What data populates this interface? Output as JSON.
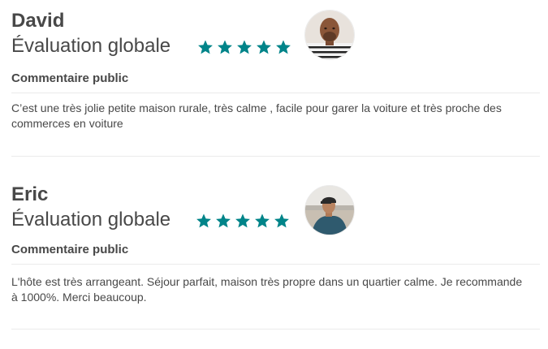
{
  "reviews": [
    {
      "name": "David",
      "rating_label": "Évaluation globale",
      "stars": 5,
      "avatar": "person-avatar",
      "comment_heading": "Commentaire public",
      "comment": "C’est une très jolie petite maison rurale, très calme , facile pour garer la voiture et très proche des commerces en voiture"
    },
    {
      "name": "Eric",
      "rating_label": "Évaluation globale",
      "stars": 5,
      "avatar": "person-avatar",
      "comment_heading": "Commentaire public",
      "comment": "L'hôte est très arrangeant. Séjour parfait, maison très propre dans un quartier calme. Je recommande à 1000%. Merci beaucoup."
    }
  ],
  "colors": {
    "star": "#008489",
    "text": "#484848",
    "divider": "#ebebeb"
  }
}
